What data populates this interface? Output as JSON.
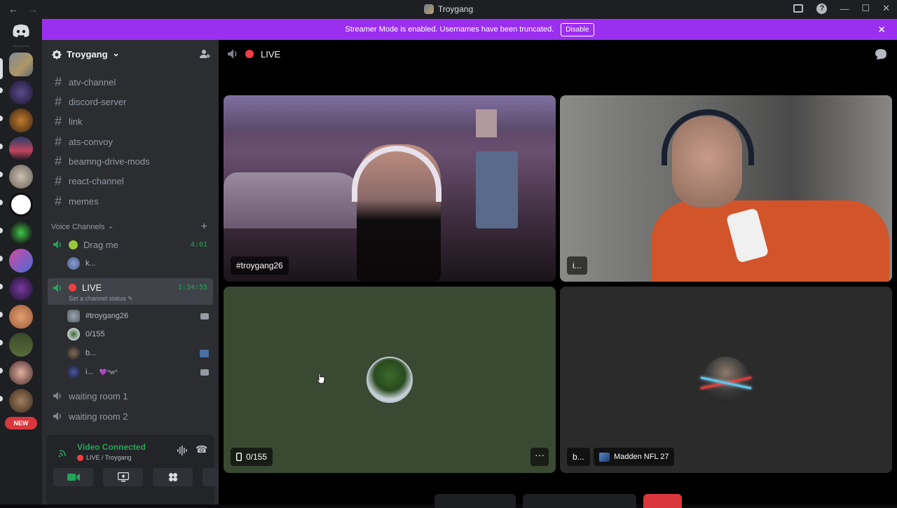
{
  "window": {
    "title": "Troygang",
    "back_arrow": "←",
    "forward_arrow": "→",
    "help_glyph": "?",
    "minimize_glyph": "—",
    "maximize_glyph": "☐",
    "close_glyph": "✕"
  },
  "banner": {
    "text": "Streamer Mode is enabled. Usernames have been truncated.",
    "button": "Disable",
    "close_glyph": "✕",
    "color": "#9b2ff0"
  },
  "rail": {
    "new_badge": "NEW"
  },
  "guild": {
    "name": "Troygang",
    "chevron": "⌄"
  },
  "text_channels": [
    {
      "hash": "#",
      "name": "atv-channel"
    },
    {
      "hash": "#",
      "name": "discord-server"
    },
    {
      "hash": "#",
      "name": "link"
    },
    {
      "hash": "#",
      "name": "ats-convoy"
    },
    {
      "hash": "#",
      "name": "beamng-drive-mods"
    },
    {
      "hash": "#",
      "name": "react-channel"
    },
    {
      "hash": "#",
      "name": "memes"
    }
  ],
  "voice_category": {
    "label": "Voice Channels",
    "chevron": "⌄",
    "add": "+"
  },
  "voice_channels": {
    "drag_me": {
      "name": "Drag me",
      "time": "4:01",
      "user": "k..."
    },
    "live": {
      "name": "LIVE",
      "time": "1:34:55",
      "status": "Set a channel status",
      "users": [
        {
          "name": "#troygang26",
          "extra": ""
        },
        {
          "name": "0/155",
          "extra": ""
        },
        {
          "name": "b...",
          "extra": ""
        },
        {
          "name": "i...",
          "extra": "💜^w^"
        }
      ]
    },
    "waiting1": {
      "name": "waiting room 1"
    },
    "waiting2": {
      "name": "waiting room 2"
    }
  },
  "rtc": {
    "status": "Video Connected",
    "location": "LIVE / Troygang",
    "hangup_glyph": "☎"
  },
  "main": {
    "channel": "LIVE"
  },
  "tiles": [
    {
      "label": "#troygang26"
    },
    {
      "label": "i..."
    },
    {
      "label": "0/155",
      "more": "···"
    },
    {
      "label": "b...",
      "game": "Madden NFL 27"
    }
  ],
  "colors": {
    "accent_green": "#23a559",
    "live_red": "#f23f43",
    "sidebar": "#2b2d31",
    "rail": "#1e1f22"
  }
}
